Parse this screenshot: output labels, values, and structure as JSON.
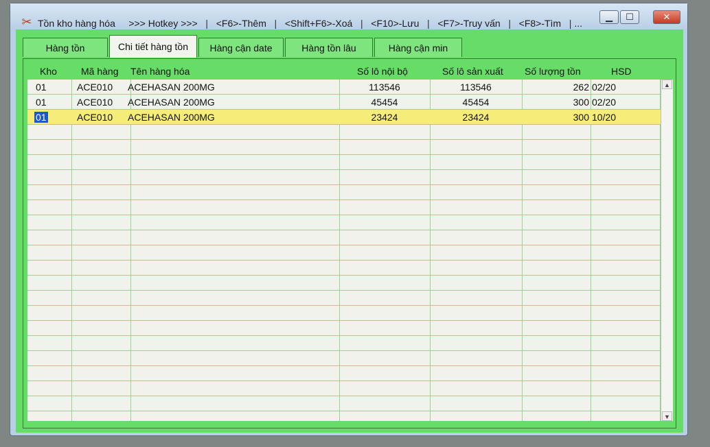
{
  "window": {
    "icon": "tools-icon",
    "title": "Tồn kho hàng hóa",
    "hotkey_label": ">>> Hotkey >>>",
    "hotkeys": [
      "<F6>-Thêm",
      "<Shift+F6>-Xoá",
      "<F10>-Lưu",
      "<F7>-Truy vấn",
      "<F8>-Tìm",
      "..."
    ],
    "controls": {
      "minimize": "minimize-icon",
      "maximize": "maximize-icon",
      "close": "close-icon"
    }
  },
  "tabs": [
    {
      "label": "Hàng tồn",
      "active": false
    },
    {
      "label": "Chi tiết hàng tồn",
      "active": true
    },
    {
      "label": "Hàng cận date",
      "active": false
    },
    {
      "label": "Hàng tồn lâu",
      "active": false
    },
    {
      "label": "Hàng cận min",
      "active": false
    }
  ],
  "grid": {
    "columns": [
      "Kho",
      "Mã hàng",
      "Tên hàng hóa",
      "Số lô nội bộ",
      "Số lô sản xuất",
      "Số lượng tồn",
      "HSD"
    ],
    "rows": [
      {
        "kho": "01",
        "ma_hang": "ACE010",
        "ten_hang": "ACEHASAN 200MG",
        "so_lo_noi_bo": "113546",
        "so_lo_san_xuat": "113546",
        "so_luong_ton": "262",
        "hsd": "02/20"
      },
      {
        "kho": "01",
        "ma_hang": "ACE010",
        "ten_hang": "ACEHASAN 200MG",
        "so_lo_noi_bo": "45454",
        "so_lo_san_xuat": "45454",
        "so_luong_ton": "300",
        "hsd": "02/20"
      },
      {
        "kho": "01",
        "ma_hang": "ACE010",
        "ten_hang": "ACEHASAN 200MG",
        "so_lo_noi_bo": "23424",
        "so_lo_san_xuat": "23424",
        "so_luong_ton": "300",
        "hsd": "10/20"
      }
    ],
    "selected_row": 2,
    "scrollbar": {
      "up": "scroll-up-arrow-icon",
      "down": "scroll-down-arrow-icon"
    }
  },
  "colors": {
    "frame_green": "#66dd66",
    "grid_background": "#f1f2ec",
    "selected_row": "#f5ec7a",
    "cell_selection": "#1f57c7"
  }
}
